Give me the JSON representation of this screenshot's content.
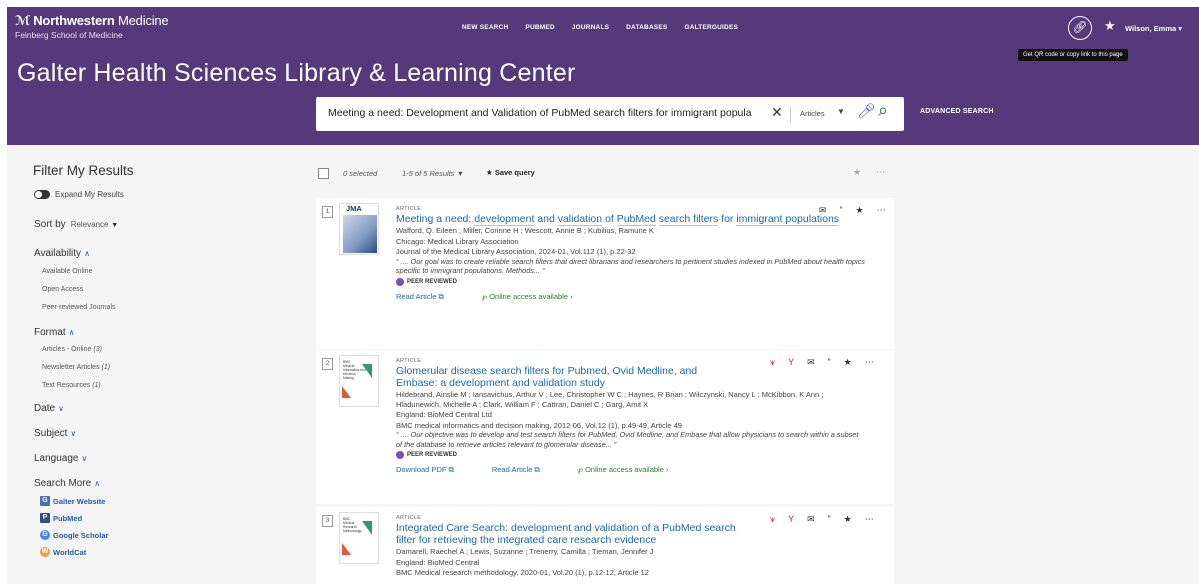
{
  "header": {
    "logo_main": "Northwestern",
    "logo_light": "Medicine",
    "logo_sub": "Feinberg School of Medicine",
    "nav": [
      "NEW SEARCH",
      "PUBMED",
      "JOURNALS",
      "DATABASES",
      "GALTERGUIDES"
    ],
    "user": "Wilson, Emma",
    "tooltip": "Get QR code or copy link to this page",
    "site_title": "Galter Health Sciences Library & Learning Center"
  },
  "search": {
    "query": "Meeting a need: Development and Validation of PubMed search filters for immigrant popula",
    "scope": "Articles",
    "advanced": "ADVANCED SEARCH"
  },
  "sidebar": {
    "title": "Filter My Results",
    "expand_label": "Expand My Results",
    "sort_label": "Sort by",
    "sort_value": "Relevance",
    "availability": {
      "label": "Availability",
      "items": [
        "Available Online",
        "Open Access",
        "Peer-reviewed Journals"
      ]
    },
    "format": {
      "label": "Format",
      "items": [
        {
          "name": "Articles - Online",
          "count": "(3)"
        },
        {
          "name": "Newsletter Articles",
          "count": "(1)"
        },
        {
          "name": "Text Resources",
          "count": "(1)"
        }
      ]
    },
    "date_label": "Date",
    "subject_label": "Subject",
    "language_label": "Language",
    "search_more": {
      "label": "Search More",
      "items": [
        "Galter Website",
        "PubMed",
        "Google Scholar",
        "WorldCat"
      ]
    }
  },
  "results_toolbar": {
    "selected": "0 selected",
    "count": "1-5 of 5 Results",
    "save_query": "Save query"
  },
  "results": [
    {
      "num": "1",
      "type": "ARTICLE",
      "title_parts": [
        "Meeting a need: ",
        "development",
        " and ",
        "validation",
        " of ",
        "PubMed",
        " ",
        "search filters",
        " for ",
        "immigrant populations"
      ],
      "authors": "Wafford, Q. Eileen ; Miller, Corinne H ; Wescott, Annie B ; Kubilius, Ramune K",
      "line2": "Chicago: Medical Library Association",
      "line3": "Journal of the Medical Library Association, 2024-01, Vol.112 (1), p.22-32",
      "snippet": "“ .... Our goal was to create reliable search filters that direct librarians and researchers to pertinent studies indexed in PubMed about health topics specific to immigrant populations. Methods... ”",
      "peer": "PEER REVIEWED",
      "links": [
        "Read Article ⧉",
        "℘ Online access available ›"
      ]
    },
    {
      "num": "2",
      "type": "ARTICLE",
      "title": "Glomerular disease search filters for Pubmed, Ovid Medline, and Embase: a development and validation study",
      "authors": "Hildebrand, Ainslie M ; Iansavichus, Arthur V ; Lee, Christopher W C ; Haynes, R Brian ; Wilczynski, Nancy L ; McKibbon, K Ann ; Hladunewich, Michelle A ; Clark, William F ; Cattran, Daniel C ; Garg, Amit X",
      "line2": "England: BioMed Central Ltd",
      "line3": "BMC medical informatics and decision making, 2012-06, Vol.12 (1), p.49-49, Article 49",
      "snippet": "“ .... Our objective was to develop and test search filters for PubMed, Ovid Medline, and Embase that allow physicians to search within a subset of the database to retrieve articles relevant to glomerular disease... ”",
      "peer": "PEER REVIEWED",
      "links": [
        "Download PDF ⧉",
        "Read Article ⧉",
        "℘ Online access available ›"
      ]
    },
    {
      "num": "3",
      "type": "ARTICLE",
      "title": "Integrated Care Search: development and validation of a PubMed search filter for retrieving the integrated care research evidence",
      "authors": "Damarell, Raechel A ; Lewis, Suzanne ; Trenerry, Camilla ; Tieman, Jennifer J",
      "line2": "England: BioMed Central",
      "line3": "BMC Medical research methodology, 2020-01, Vol.20 (1), p.12-12, Article 12"
    }
  ]
}
